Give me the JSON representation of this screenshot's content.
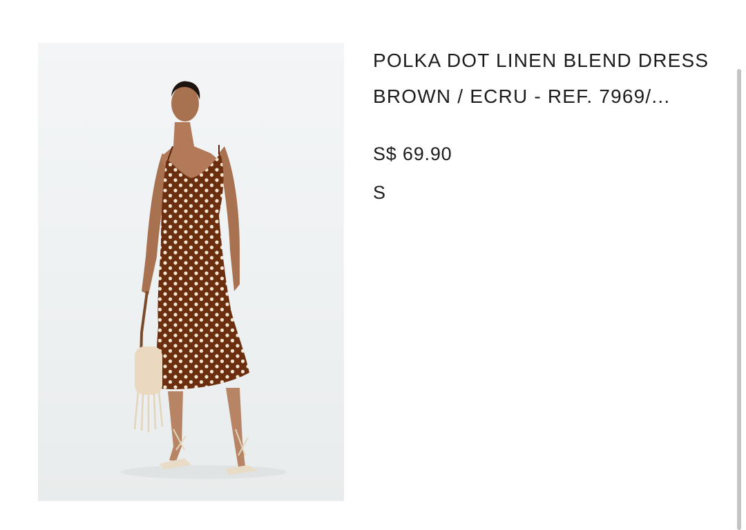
{
  "product": {
    "image_alt": "model wearing polka dot dress",
    "title": "POLKA DOT LINEN BLEND DRESS",
    "colour_ref": "BROWN / ECRU - REF. 7969/...",
    "price": "S$ 69.90",
    "size": "S"
  },
  "colors": {
    "dress": "#6b2f10",
    "dots": "#f2e6d2",
    "background": "#ffffff",
    "text": "#1c1c1c"
  }
}
